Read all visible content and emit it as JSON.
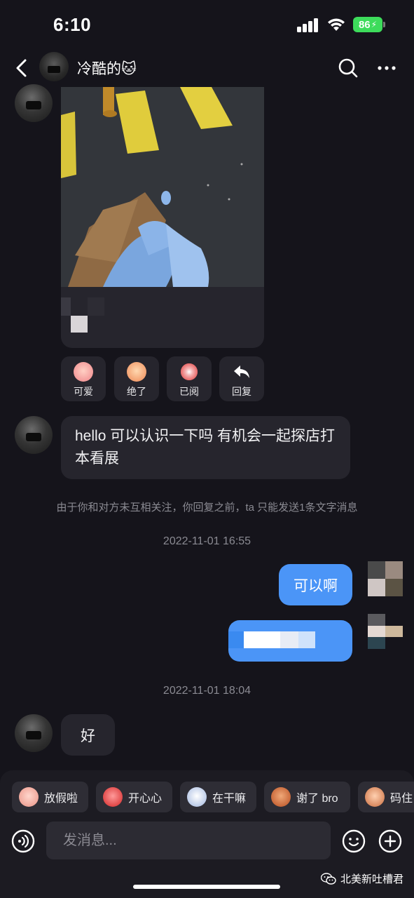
{
  "status_bar": {
    "time": "6:10",
    "battery": "86"
  },
  "header": {
    "contact_name": "冷酷的🐱"
  },
  "reactions": [
    {
      "label": "可爱",
      "color": "#f7a8a8"
    },
    {
      "label": "绝了",
      "color": "#f5b48a"
    },
    {
      "label": "已阅",
      "color": "#f08a8a"
    },
    {
      "label": "回复",
      "icon": "reply-arrow-icon"
    }
  ],
  "messages": {
    "incoming_1": "hello 可以认识一下吗 有机会一起探店打本看展",
    "notice": "由于你和对方未互相关注，你回复之前，ta 只能发送1条文字消息",
    "time_1": "2022-11-01 16:55",
    "outgoing_1": "可以啊",
    "time_2": "2022-11-01 18:04",
    "incoming_2": "好"
  },
  "quick_replies": [
    {
      "label": "放假啦",
      "color": "#f3b2a6"
    },
    {
      "label": "开心心",
      "color": "#e85a5a"
    },
    {
      "label": "在干嘛",
      "color": "#c9d7f0"
    },
    {
      "label": "谢了 bro",
      "color": "#d9824f"
    },
    {
      "label": "码住",
      "color": "#e6a07a"
    }
  ],
  "input": {
    "placeholder": "发消息..."
  },
  "watermark": {
    "text": "北美新吐槽君"
  },
  "colors": {
    "background": "#15141b",
    "bubble_incoming": "#26252d",
    "bubble_outgoing": "#4b95f7",
    "battery": "#3ddc5b"
  }
}
